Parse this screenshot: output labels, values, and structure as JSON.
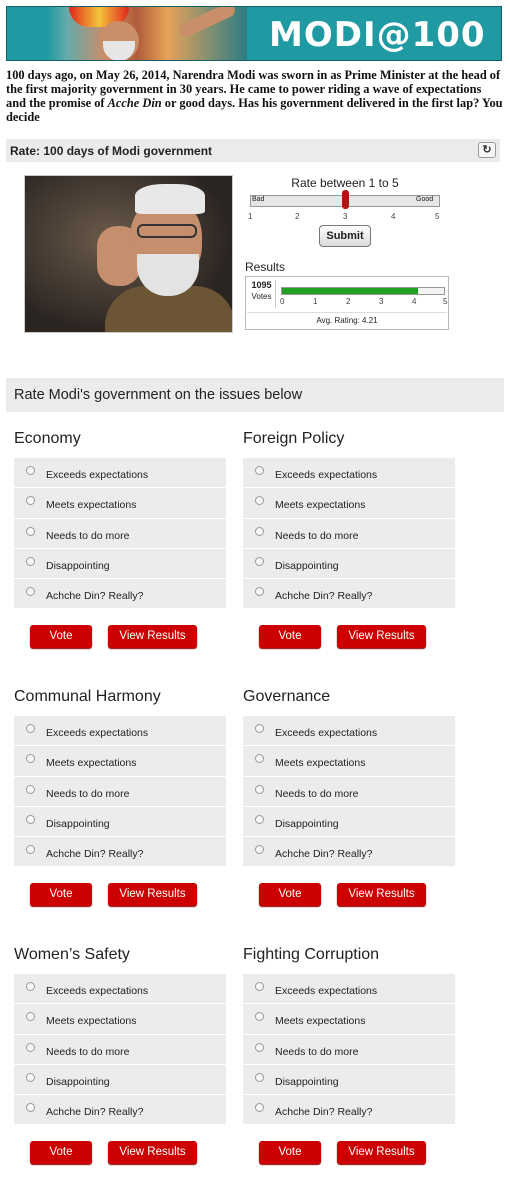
{
  "banner": {
    "title": "MODI@100"
  },
  "intro": {
    "part1": "100 days ago, on May 26, 2014, Narendra Modi was sworn in as Prime Minister at the head of the first majority government in 30 years. He came to power riding a wave of expectations and the promise of ",
    "italic": "Acche Din",
    "part2": " or good days. Has his government delivered in the first lap? You decide"
  },
  "rate_widget": {
    "header": "Rate: 100 days of Modi government",
    "refresh_icon": "refresh-icon",
    "prompt": "Rate between 1 to 5",
    "slider_low": "Bad",
    "slider_high": "Good",
    "slider_value": 3,
    "scale": [
      "1",
      "2",
      "3",
      "4",
      "5"
    ],
    "submit_label": "Submit",
    "results_label": "Results",
    "votes_count": "1095",
    "votes_label": "Votes",
    "results_scale": [
      "0",
      "1",
      "2",
      "3",
      "4",
      "5"
    ],
    "avg_rating_text": "Avg. Rating: 4.21",
    "avg_rating_value": 4.21,
    "bar_color": "#22a022"
  },
  "issues": {
    "header": "Rate Modi's government on the issues below",
    "options": [
      "Exceeds expectations",
      "Meets expectations",
      "Needs to do more",
      "Disappointing",
      "Achche Din? Really?"
    ],
    "vote_label": "Vote",
    "view_label": "View Results",
    "polls": [
      {
        "title": "Economy"
      },
      {
        "title": "Foreign Policy"
      },
      {
        "title": "Communal Harmony"
      },
      {
        "title": "Governance"
      },
      {
        "title": "Women’s Safety"
      },
      {
        "title": "Fighting Corruption"
      }
    ]
  },
  "colors": {
    "accent": "#cc0000",
    "banner": "#1f9aa2"
  }
}
